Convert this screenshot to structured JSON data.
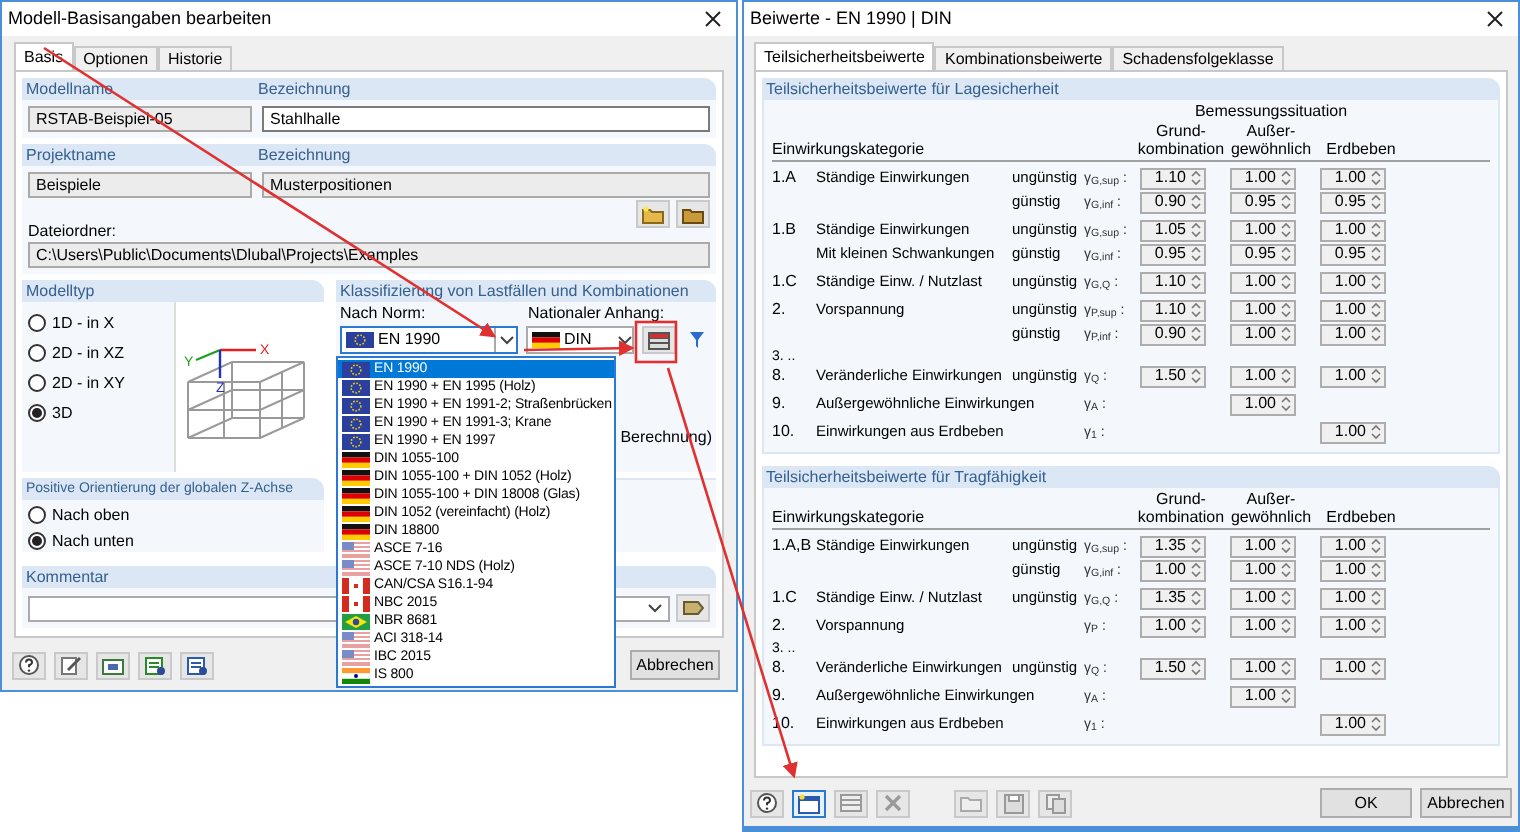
{
  "left_dialog": {
    "title": "Modell-Basisangaben bearbeiten",
    "tabs": [
      {
        "label": "Basis",
        "selected": true
      },
      {
        "label": "Optionen",
        "selected": false
      },
      {
        "label": "Historie",
        "selected": false
      }
    ],
    "model": {
      "name_label": "Modellname",
      "name": "RSTAB-Beispiel-05",
      "description_label": "Bezeichnung",
      "description": "Stahlhalle"
    },
    "project": {
      "name_label": "Projektname",
      "name": "Beispiele",
      "description_label": "Bezeichnung",
      "description": "Musterpositionen",
      "folder_label": "Dateiordner:",
      "folder": "C:\\Users\\Public\\Documents\\Dlubal\\Projects\\Examples"
    },
    "model_type": {
      "title": "Modelltyp",
      "axes": [
        "X",
        "Y",
        "Z"
      ],
      "options": [
        {
          "label": "1D - in X",
          "selected": false
        },
        {
          "label": "2D - in XZ",
          "selected": false
        },
        {
          "label": "2D - in XY",
          "selected": false
        },
        {
          "label": "3D",
          "selected": true
        }
      ]
    },
    "classification": {
      "title": "Klassifizierung von Lastfällen und Kombinationen",
      "standard_label": "Nach Norm:",
      "standard": {
        "text": "EN 1990",
        "kind": "eu"
      },
      "annex_label": "Nationaler Anhang:",
      "annex": {
        "text": "DIN",
        "kind": "de"
      },
      "partial_text": "Berechnung)"
    },
    "standard_list": [
      {
        "text": "EN 1990",
        "kind": "eu",
        "selected": true
      },
      {
        "text": "EN 1990 + EN 1995 (Holz)",
        "kind": "eu",
        "selected": false
      },
      {
        "text": "EN 1990 + EN 1991-2; Straßenbrücken",
        "kind": "eu",
        "selected": false
      },
      {
        "text": "EN 1990 + EN 1991-3; Krane",
        "kind": "eu",
        "selected": false
      },
      {
        "text": "EN 1990 + EN 1997",
        "kind": "eu",
        "selected": false
      },
      {
        "text": "DIN 1055-100",
        "kind": "de",
        "selected": false
      },
      {
        "text": "DIN 1055-100 + DIN 1052 (Holz)",
        "kind": "de",
        "selected": false
      },
      {
        "text": "DIN 1055-100 + DIN 18008 (Glas)",
        "kind": "de",
        "selected": false
      },
      {
        "text": "DIN 1052 (vereinfacht) (Holz)",
        "kind": "de",
        "selected": false
      },
      {
        "text": "DIN 18800",
        "kind": "de",
        "selected": false
      },
      {
        "text": "ASCE 7-16",
        "kind": "us",
        "selected": false
      },
      {
        "text": "ASCE 7-10 NDS (Holz)",
        "kind": "us",
        "selected": false
      },
      {
        "text": "CAN/CSA S16.1-94",
        "kind": "ca",
        "selected": false
      },
      {
        "text": "NBC 2015",
        "kind": "ca",
        "selected": false
      },
      {
        "text": "NBR 8681",
        "kind": "br",
        "selected": false
      },
      {
        "text": "ACI 318-14",
        "kind": "us",
        "selected": false
      },
      {
        "text": "IBC 2015",
        "kind": "us",
        "selected": false
      },
      {
        "text": "IS 800",
        "kind": "in",
        "selected": false
      }
    ],
    "z_orientation": {
      "title": "Positive Orientierung der globalen Z-Achse",
      "options": [
        {
          "label": "Nach oben",
          "selected": false
        },
        {
          "label": "Nach unten",
          "selected": true
        }
      ]
    },
    "comment": {
      "title": "Kommentar"
    },
    "cancel_button": "Abbrechen"
  },
  "right_dialog": {
    "title": "Beiwerte - EN 1990 | DIN",
    "tabs": [
      {
        "label": "Teilsicherheitsbeiwerte",
        "selected": true
      },
      {
        "label": "Kombinationsbeiwerte",
        "selected": false
      },
      {
        "label": "Schadensfolgeklasse",
        "selected": false
      }
    ],
    "sections": [
      {
        "title": "Teilsicherheitsbeiwerte für Lagesicherheit",
        "situation_label": "Bemessungssituation",
        "category_label": "Einwirkungskategorie",
        "columns": [
          "Grund-\nkombination",
          "Außer-\ngewöhnlich",
          "Erdbeben"
        ],
        "entries": [
          {
            "number": "1.A",
            "lines": [
              {
                "label": "Ständige Einwirkungen",
                "condition": "ungünstig",
                "symbol": "γ$_{G,sup}$ :",
                "basic": "1.10",
                "accidental": "1.00",
                "seismic": "1.00"
              },
              {
                "condition": "günstig",
                "symbol": "γ$_{G,inf}$ :",
                "basic": "0.90",
                "accidental": "0.95",
                "seismic": "0.95"
              }
            ]
          },
          {
            "number": "1.B",
            "lines": [
              {
                "label": "Ständige Einwirkungen",
                "condition": "ungünstig",
                "symbol": "γ$_{G,sup}$ :",
                "basic": "1.05",
                "accidental": "1.00",
                "seismic": "1.00"
              },
              {
                "label": "Mit kleinen Schwankungen",
                "condition": "günstig",
                "symbol": "γ$_{G,inf}$ :",
                "basic": "0.95",
                "accidental": "0.95",
                "seismic": "0.95"
              }
            ]
          },
          {
            "number": "1.C",
            "lines": [
              {
                "label": "Ständige Einw. / Nutzlast",
                "condition": "ungünstig",
                "symbol": "γ$_{G,Q}$ :",
                "basic": "1.10",
                "accidental": "1.00",
                "seismic": "1.00"
              }
            ]
          },
          {
            "number": "2.",
            "lines": [
              {
                "label": "Vorspannung",
                "condition": "ungünstig",
                "symbol": "γ$_{P,sup}$ :",
                "basic": "1.10",
                "accidental": "1.00",
                "seismic": "1.00"
              },
              {
                "condition": "günstig",
                "symbol": "γ$_{P,inf}$ :",
                "basic": "0.90",
                "accidental": "1.00",
                "seismic": "1.00"
              }
            ]
          },
          {
            "number_above": "3. ..",
            "number": "8.",
            "lines": [
              {
                "label": "Veränderliche Einwirkungen",
                "condition": "ungünstig",
                "symbol": "γ$_{Q}$ :",
                "basic": "1.50",
                "accidental": "1.00",
                "seismic": "1.00"
              }
            ]
          },
          {
            "number": "9.",
            "lines": [
              {
                "label": "Außergewöhnliche Einwirkungen",
                "symbol": "γ$_{A}$ :",
                "accidental": "1.00"
              }
            ]
          },
          {
            "number": "10.",
            "lines": [
              {
                "label": "Einwirkungen aus Erdbeben",
                "symbol": "γ$_{1}$ :",
                "seismic": "1.00"
              }
            ]
          }
        ]
      },
      {
        "title": "Teilsicherheitsbeiwerte für Tragfähigkeit",
        "category_label": "Einwirkungskategorie",
        "columns": [
          "Grund-\nkombination",
          "Außer-\ngewöhnlich",
          "Erdbeben"
        ],
        "entries": [
          {
            "number": "1.A,B",
            "lines": [
              {
                "label": "Ständige Einwirkungen",
                "condition": "ungünstig",
                "symbol": "γ$_{G,sup}$ :",
                "basic": "1.35",
                "accidental": "1.00",
                "seismic": "1.00"
              },
              {
                "condition": "günstig",
                "symbol": "γ$_{G,inf}$ :",
                "basic": "1.00",
                "accidental": "1.00",
                "seismic": "1.00"
              }
            ]
          },
          {
            "number": "1.C",
            "lines": [
              {
                "label": "Ständige Einw. / Nutzlast",
                "condition": "ungünstig",
                "symbol": "γ$_{G,Q}$ :",
                "basic": "1.35",
                "accidental": "1.00",
                "seismic": "1.00"
              }
            ]
          },
          {
            "number": "2.",
            "lines": [
              {
                "label": "Vorspannung",
                "symbol": "γ$_{P}$ :",
                "basic": "1.00",
                "accidental": "1.00",
                "seismic": "1.00"
              }
            ]
          },
          {
            "number_above": "3. ..",
            "number": "8.",
            "lines": [
              {
                "label": "Veränderliche Einwirkungen",
                "condition": "ungünstig",
                "symbol": "γ$_{Q}$ :",
                "basic": "1.50",
                "accidental": "1.00",
                "seismic": "1.00"
              }
            ]
          },
          {
            "number": "9.",
            "lines": [
              {
                "label": "Außergewöhnliche Einwirkungen",
                "symbol": "γ$_{A}$ :",
                "accidental": "1.00"
              }
            ]
          },
          {
            "number": "10.",
            "lines": [
              {
                "label": "Einwirkungen aus Erdbeben",
                "symbol": "γ$_{1}$ :",
                "seismic": "1.00"
              }
            ]
          }
        ]
      }
    ],
    "ok_button": "OK",
    "cancel_button": "Abbrechen"
  }
}
